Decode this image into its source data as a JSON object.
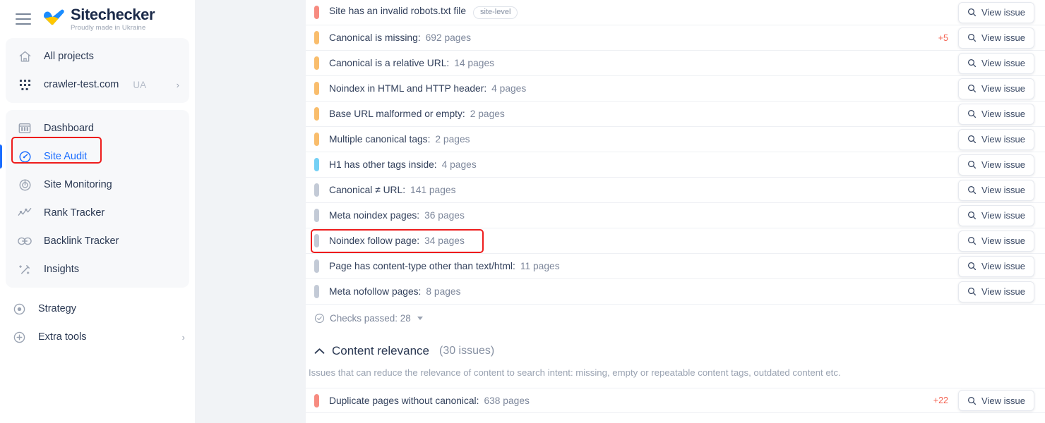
{
  "brand": {
    "name": "Sitechecker",
    "tagline": "Proudly made in Ukraine",
    "menu_icon": "hamburger-menu-icon",
    "logo_icon": "ukraine-heart-logo-icon"
  },
  "sidebar": {
    "group_primary": [
      {
        "label": "All projects",
        "icon": "home-icon",
        "active": false,
        "sub": "",
        "chevron": ""
      },
      {
        "label": "crawler-test.com",
        "icon": "grid-dots-icon",
        "active": false,
        "sub": "UA",
        "chevron": "›"
      }
    ],
    "group_main": [
      {
        "label": "Dashboard",
        "icon": "dashboard-columns-icon",
        "active": false,
        "sub": "",
        "chevron": ""
      },
      {
        "label": "Site Audit",
        "icon": "gauge-icon",
        "active": true,
        "sub": "",
        "chevron": ""
      },
      {
        "label": "Site Monitoring",
        "icon": "radar-icon",
        "active": false,
        "sub": "",
        "chevron": ""
      },
      {
        "label": "Rank Tracker",
        "icon": "line-chart-icon",
        "active": false,
        "sub": "",
        "chevron": ""
      },
      {
        "label": "Backlink Tracker",
        "icon": "link-icon",
        "active": false,
        "sub": "",
        "chevron": ""
      },
      {
        "label": "Insights",
        "icon": "magic-wand-icon",
        "active": false,
        "sub": "",
        "chevron": ""
      }
    ],
    "group_bottom": [
      {
        "label": "Strategy",
        "icon": "target-icon",
        "active": false,
        "sub": "",
        "chevron": ""
      },
      {
        "label": "Extra tools",
        "icon": "plus-circle-icon",
        "active": false,
        "sub": "",
        "chevron": "›"
      }
    ]
  },
  "colors": {
    "severity_critical": "#f78b80",
    "severity_warning": "#f9bd6c",
    "severity_info": "#74d0f5",
    "severity_notice": "#c3cad6",
    "accent_blue": "#1a6dff",
    "delta_red": "#f4604f",
    "highlight_box": "#ee1c1c"
  },
  "main": {
    "view_issue_label": "View issue",
    "view_issue_icon": "search-icon",
    "issue_rows": [
      {
        "severity": "critical",
        "title": "Site has an invalid robots.txt file",
        "count": "",
        "badge": "site-level",
        "delta": "",
        "highlight": false
      },
      {
        "severity": "warning",
        "title": "Canonical is missing:",
        "count": "692 pages",
        "badge": "",
        "delta": "+5",
        "highlight": false
      },
      {
        "severity": "warning",
        "title": "Canonical is a relative URL:",
        "count": "14 pages",
        "badge": "",
        "delta": "",
        "highlight": false
      },
      {
        "severity": "warning",
        "title": "Noindex in HTML and HTTP header:",
        "count": "4 pages",
        "badge": "",
        "delta": "",
        "highlight": false
      },
      {
        "severity": "warning",
        "title": "Base URL malformed or empty:",
        "count": "2 pages",
        "badge": "",
        "delta": "",
        "highlight": false
      },
      {
        "severity": "warning",
        "title": "Multiple canonical tags:",
        "count": "2 pages",
        "badge": "",
        "delta": "",
        "highlight": false
      },
      {
        "severity": "info",
        "title": "H1 has other tags inside:",
        "count": "4 pages",
        "badge": "",
        "delta": "",
        "highlight": false
      },
      {
        "severity": "notice",
        "title": "Canonical ≠ URL:",
        "count": "141 pages",
        "badge": "",
        "delta": "",
        "highlight": false
      },
      {
        "severity": "notice",
        "title": "Meta noindex pages:",
        "count": "36 pages",
        "badge": "",
        "delta": "",
        "highlight": false
      },
      {
        "severity": "notice",
        "title": "Noindex follow page:",
        "count": "34 pages",
        "badge": "",
        "delta": "",
        "highlight": true
      },
      {
        "severity": "notice",
        "title": "Page has content-type other than text/html:",
        "count": "11 pages",
        "badge": "",
        "delta": "",
        "highlight": false
      },
      {
        "severity": "notice",
        "title": "Meta nofollow pages:",
        "count": "8 pages",
        "badge": "",
        "delta": "",
        "highlight": false
      }
    ],
    "checks_passed": {
      "icon": "check-circle-icon",
      "label": "Checks passed: 28"
    },
    "section": {
      "collapse_icon": "chevron-up-icon",
      "title": "Content relevance",
      "count": "(30 issues)",
      "description": "Issues that can reduce the relevance of content to search intent: missing, empty or repeatable content tags, outdated content etc.",
      "rows": [
        {
          "severity": "critical",
          "title": "Duplicate pages without canonical:",
          "count": "638 pages",
          "badge": "",
          "delta": "+22",
          "highlight": false
        }
      ]
    }
  }
}
